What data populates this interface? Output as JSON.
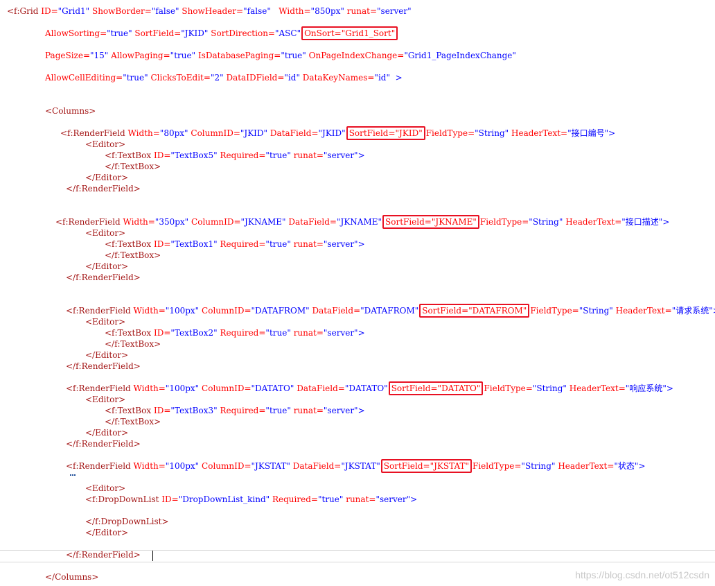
{
  "theme": {
    "tag_color": "#a31515",
    "attr_color": "#ff0000",
    "value_color": "#0000ff",
    "highlight_box_color": "#e81123",
    "background": "#ffffff"
  },
  "code_lines": [
    {
      "tokens": [
        {
          "t": "<f:Grid",
          "c": "tag"
        },
        {
          "t": " "
        },
        {
          "t": "ID=",
          "c": "attr"
        },
        {
          "t": "\"Grid1\"",
          "c": "val"
        },
        {
          "t": " "
        },
        {
          "t": "ShowBorder=",
          "c": "attr"
        },
        {
          "t": "\"false\"",
          "c": "val"
        },
        {
          "t": " "
        },
        {
          "t": "ShowHeader=",
          "c": "attr"
        },
        {
          "t": "\"false\"",
          "c": "val"
        },
        {
          "t": "   "
        },
        {
          "t": "Width=",
          "c": "attr"
        },
        {
          "t": "\"850px\"",
          "c": "val"
        },
        {
          "t": " "
        },
        {
          "t": "runat=",
          "c": "attr"
        },
        {
          "t": "\"server\"",
          "c": "val"
        }
      ]
    },
    {
      "tokens": [
        {
          "t": "AllowSorting=",
          "c": "attr"
        },
        {
          "t": "\"true\"",
          "c": "val"
        },
        {
          "t": " "
        },
        {
          "t": "SortField=",
          "c": "attr"
        },
        {
          "t": "\"JKID\"",
          "c": "val"
        },
        {
          "t": " "
        },
        {
          "t": "SortDirection=",
          "c": "attr"
        },
        {
          "t": "\"ASC\"",
          "c": "val"
        },
        {
          "t": "OnSort=\"Grid1_Sort\"",
          "c": "attr",
          "hl": true
        }
      ]
    },
    {
      "tokens": [
        {
          "t": "PageSize=",
          "c": "attr"
        },
        {
          "t": "\"15\"",
          "c": "val"
        },
        {
          "t": " "
        },
        {
          "t": "AllowPaging=",
          "c": "attr"
        },
        {
          "t": "\"true\"",
          "c": "val"
        },
        {
          "t": " "
        },
        {
          "t": "IsDatabasePaging=",
          "c": "attr"
        },
        {
          "t": "\"true\"",
          "c": "val"
        },
        {
          "t": " "
        },
        {
          "t": "OnPageIndexChange=",
          "c": "attr"
        },
        {
          "t": "\"Grid1_PageIndexChange\"",
          "c": "val"
        }
      ]
    },
    {
      "tokens": [
        {
          "t": "AllowCellEditing=",
          "c": "attr"
        },
        {
          "t": "\"true\"",
          "c": "val"
        },
        {
          "t": " "
        },
        {
          "t": "ClicksToEdit=",
          "c": "attr"
        },
        {
          "t": "\"2\"",
          "c": "val"
        },
        {
          "t": " "
        },
        {
          "t": "DataIDField=",
          "c": "attr"
        },
        {
          "t": "\"id\"",
          "c": "val"
        },
        {
          "t": " "
        },
        {
          "t": "DataKeyNames=",
          "c": "attr"
        },
        {
          "t": "\"id\"",
          "c": "val"
        },
        {
          "t": "  >",
          "c": "plain"
        }
      ]
    },
    {
      "tokens": [
        {
          "t": "<Columns>",
          "c": "tag"
        }
      ]
    },
    {
      "tokens": [
        {
          "t": "<f:RenderField",
          "c": "tag"
        },
        {
          "t": " "
        },
        {
          "t": "Width=",
          "c": "attr"
        },
        {
          "t": "\"80px\"",
          "c": "val"
        },
        {
          "t": " "
        },
        {
          "t": "ColumnID=",
          "c": "attr"
        },
        {
          "t": "\"JKID\"",
          "c": "val"
        },
        {
          "t": " "
        },
        {
          "t": "DataField=",
          "c": "attr"
        },
        {
          "t": "\"JKID\"",
          "c": "val"
        },
        {
          "t": "SortField=\"JKID\"",
          "c": "attr",
          "hl": true
        },
        {
          "t": "FieldType=",
          "c": "attr"
        },
        {
          "t": "\"String\"",
          "c": "val"
        },
        {
          "t": " "
        },
        {
          "t": "HeaderText=",
          "c": "attr"
        },
        {
          "t": "\"接口编号\"",
          "c": "val"
        },
        {
          "t": ">",
          "c": "plain"
        }
      ]
    },
    {
      "tokens": [
        {
          "t": "<Editor>",
          "c": "tag"
        }
      ]
    },
    {
      "tokens": [
        {
          "t": "<f:TextBox",
          "c": "tag"
        },
        {
          "t": " "
        },
        {
          "t": "ID=",
          "c": "attr"
        },
        {
          "t": "\"TextBox5\"",
          "c": "val"
        },
        {
          "t": " "
        },
        {
          "t": "Required=",
          "c": "attr"
        },
        {
          "t": "\"true\"",
          "c": "val"
        },
        {
          "t": " "
        },
        {
          "t": "runat=",
          "c": "attr"
        },
        {
          "t": "\"server\"",
          "c": "val"
        },
        {
          "t": ">",
          "c": "plain"
        }
      ]
    },
    {
      "tokens": [
        {
          "t": "</f:TextBox>",
          "c": "tag"
        }
      ]
    },
    {
      "tokens": [
        {
          "t": "</Editor>",
          "c": "tag"
        }
      ]
    },
    {
      "tokens": [
        {
          "t": "</f:RenderField>",
          "c": "tag"
        }
      ]
    },
    {
      "tokens": [
        {
          "t": "<f:RenderField",
          "c": "tag"
        },
        {
          "t": " "
        },
        {
          "t": "Width=",
          "c": "attr"
        },
        {
          "t": "\"350px\"",
          "c": "val"
        },
        {
          "t": " "
        },
        {
          "t": "ColumnID=",
          "c": "attr"
        },
        {
          "t": "\"JKNAME\"",
          "c": "val"
        },
        {
          "t": " "
        },
        {
          "t": "DataField=",
          "c": "attr"
        },
        {
          "t": "\"JKNAME\"",
          "c": "val"
        },
        {
          "t": "SortField=\"JKNAME\"",
          "c": "attr",
          "hl": true
        },
        {
          "t": "FieldType=",
          "c": "attr"
        },
        {
          "t": "\"String\"",
          "c": "val"
        },
        {
          "t": " "
        },
        {
          "t": "HeaderText=",
          "c": "attr"
        },
        {
          "t": "\"接口描述\"",
          "c": "val"
        },
        {
          "t": ">",
          "c": "plain"
        }
      ]
    },
    {
      "tokens": [
        {
          "t": "<Editor>",
          "c": "tag"
        }
      ]
    },
    {
      "tokens": [
        {
          "t": "<f:TextBox",
          "c": "tag"
        },
        {
          "t": " "
        },
        {
          "t": "ID=",
          "c": "attr"
        },
        {
          "t": "\"TextBox1\"",
          "c": "val"
        },
        {
          "t": " "
        },
        {
          "t": "Required=",
          "c": "attr"
        },
        {
          "t": "\"true\"",
          "c": "val"
        },
        {
          "t": " "
        },
        {
          "t": "runat=",
          "c": "attr"
        },
        {
          "t": "\"server\"",
          "c": "val"
        },
        {
          "t": ">",
          "c": "plain"
        }
      ]
    },
    {
      "tokens": [
        {
          "t": "</f:TextBox>",
          "c": "tag"
        }
      ]
    },
    {
      "tokens": [
        {
          "t": "</Editor>",
          "c": "tag"
        }
      ]
    },
    {
      "tokens": [
        {
          "t": "</f:RenderField>",
          "c": "tag"
        }
      ]
    },
    {
      "tokens": [
        {
          "t": "<f:RenderField",
          "c": "tag"
        },
        {
          "t": " "
        },
        {
          "t": "Width=",
          "c": "attr"
        },
        {
          "t": "\"100px\"",
          "c": "val"
        },
        {
          "t": " "
        },
        {
          "t": "ColumnID=",
          "c": "attr"
        },
        {
          "t": "\"DATAFROM\"",
          "c": "val"
        },
        {
          "t": " "
        },
        {
          "t": "DataField=",
          "c": "attr"
        },
        {
          "t": "\"DATAFROM\"",
          "c": "val"
        },
        {
          "t": "SortField=\"DATAFROM\"",
          "c": "attr",
          "hl": true
        },
        {
          "t": "FieldType=",
          "c": "attr"
        },
        {
          "t": "\"String\"",
          "c": "val"
        },
        {
          "t": " "
        },
        {
          "t": "HeaderText=",
          "c": "attr"
        },
        {
          "t": "\"请求系统\"",
          "c": "val"
        },
        {
          "t": ">",
          "c": "plain"
        }
      ]
    },
    {
      "tokens": [
        {
          "t": "<Editor>",
          "c": "tag"
        }
      ]
    },
    {
      "tokens": [
        {
          "t": "<f:TextBox",
          "c": "tag"
        },
        {
          "t": " "
        },
        {
          "t": "ID=",
          "c": "attr"
        },
        {
          "t": "\"TextBox2\"",
          "c": "val"
        },
        {
          "t": " "
        },
        {
          "t": "Required=",
          "c": "attr"
        },
        {
          "t": "\"true\"",
          "c": "val"
        },
        {
          "t": " "
        },
        {
          "t": "runat=",
          "c": "attr"
        },
        {
          "t": "\"server\"",
          "c": "val"
        },
        {
          "t": ">",
          "c": "plain"
        }
      ]
    },
    {
      "tokens": [
        {
          "t": "</f:TextBox>",
          "c": "tag"
        }
      ]
    },
    {
      "tokens": [
        {
          "t": "</Editor>",
          "c": "tag"
        }
      ]
    },
    {
      "tokens": [
        {
          "t": "</f:RenderField>",
          "c": "tag"
        }
      ]
    },
    {
      "tokens": [
        {
          "t": "<f:RenderField",
          "c": "tag"
        },
        {
          "t": " "
        },
        {
          "t": "Width=",
          "c": "attr"
        },
        {
          "t": "\"100px\"",
          "c": "val"
        },
        {
          "t": " "
        },
        {
          "t": "ColumnID=",
          "c": "attr"
        },
        {
          "t": "\"DATATO\"",
          "c": "val"
        },
        {
          "t": " "
        },
        {
          "t": "DataField=",
          "c": "attr"
        },
        {
          "t": "\"DATATO\"",
          "c": "val"
        },
        {
          "t": "SortField=\"DATATO\"",
          "c": "attr",
          "hl": true
        },
        {
          "t": "FieldType=",
          "c": "attr"
        },
        {
          "t": "\"String\"",
          "c": "val"
        },
        {
          "t": " "
        },
        {
          "t": "HeaderText=",
          "c": "attr"
        },
        {
          "t": "\"响应系统\"",
          "c": "val"
        },
        {
          "t": ">",
          "c": "plain"
        }
      ]
    },
    {
      "tokens": [
        {
          "t": "<Editor>",
          "c": "tag"
        }
      ]
    },
    {
      "tokens": [
        {
          "t": "<f:TextBox",
          "c": "tag"
        },
        {
          "t": " "
        },
        {
          "t": "ID=",
          "c": "attr"
        },
        {
          "t": "\"TextBox3\"",
          "c": "val"
        },
        {
          "t": " "
        },
        {
          "t": "Required=",
          "c": "attr"
        },
        {
          "t": "\"true\"",
          "c": "val"
        },
        {
          "t": " "
        },
        {
          "t": "runat=",
          "c": "attr"
        },
        {
          "t": "\"server\"",
          "c": "val"
        },
        {
          "t": ">",
          "c": "plain"
        }
      ]
    },
    {
      "tokens": [
        {
          "t": "</f:TextBox>",
          "c": "tag"
        }
      ]
    },
    {
      "tokens": [
        {
          "t": "</Editor>",
          "c": "tag"
        }
      ]
    },
    {
      "tokens": [
        {
          "t": "</f:RenderField>",
          "c": "tag"
        }
      ]
    },
    {
      "tokens": [
        {
          "t": "<f:RenderField",
          "c": "tag"
        },
        {
          "t": " "
        },
        {
          "t": "Width=",
          "c": "attr"
        },
        {
          "t": "\"100px\"",
          "c": "val"
        },
        {
          "t": " "
        },
        {
          "t": "ColumnID=",
          "c": "attr"
        },
        {
          "t": "\"JKSTAT\"",
          "c": "val"
        },
        {
          "t": " "
        },
        {
          "t": "DataField=",
          "c": "attr"
        },
        {
          "t": "\"JKSTAT\"",
          "c": "val"
        },
        {
          "t": "SortField=\"JKSTAT\"",
          "c": "attr",
          "hl": true
        },
        {
          "t": "FieldType=",
          "c": "attr"
        },
        {
          "t": "\"String\"",
          "c": "val"
        },
        {
          "t": " "
        },
        {
          "t": "HeaderText=",
          "c": "attr"
        },
        {
          "t": "\"状态\"",
          "c": "val"
        },
        {
          "t": ">",
          "c": "plain"
        }
      ]
    },
    {
      "tokens": [
        {
          "t": "<Editor>",
          "c": "tag"
        }
      ]
    },
    {
      "tokens": [
        {
          "t": "<f:DropDownList",
          "c": "tag"
        },
        {
          "t": " "
        },
        {
          "t": "ID=",
          "c": "attr"
        },
        {
          "t": "\"DropDownList_kind\"",
          "c": "val"
        },
        {
          "t": " "
        },
        {
          "t": "Required=",
          "c": "attr"
        },
        {
          "t": "\"true\"",
          "c": "val"
        },
        {
          "t": " "
        },
        {
          "t": "runat=",
          "c": "attr"
        },
        {
          "t": "\"server\"",
          "c": "val"
        },
        {
          "t": ">",
          "c": "plain"
        }
      ]
    },
    {
      "tokens": [
        {
          "t": "</f:DropDownList>",
          "c": "tag"
        }
      ]
    },
    {
      "tokens": [
        {
          "t": "</Editor>",
          "c": "tag"
        }
      ]
    },
    {
      "tokens": [
        {
          "t": "</f:RenderField>",
          "c": "tag"
        }
      ]
    },
    {
      "tokens": [
        {
          "t": "</Columns>",
          "c": "tag"
        }
      ]
    }
  ],
  "watermark": "https://blog.csdn.net/ot512csdn"
}
